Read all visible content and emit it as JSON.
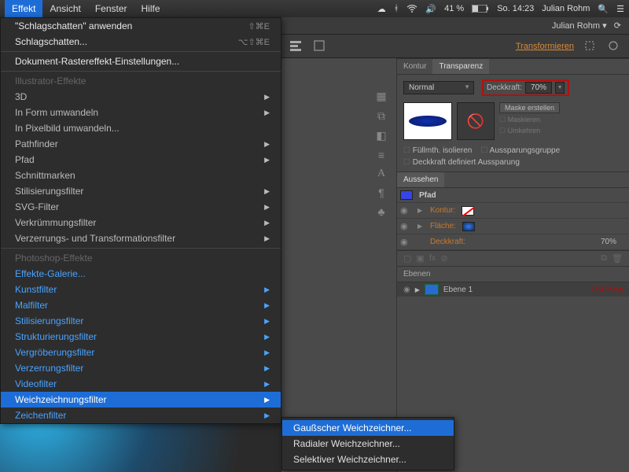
{
  "menubar": {
    "active": "Effekt",
    "items": [
      "Effekt",
      "Ansicht",
      "Fenster",
      "Hilfe"
    ],
    "battery": "41 %",
    "clock": "So. 14:23",
    "user": "Julian Rohm"
  },
  "dropdown": {
    "apply_last": "\"Schlagschatten\" anwenden",
    "apply_shortcut": "⇧⌘E",
    "last": "Schlagschatten...",
    "last_shortcut": "⌥⇧⌘E",
    "raster_settings": "Dokument-Rastereffekt-Einstellungen...",
    "section1": "Illustrator-Effekte",
    "ai_items": [
      "3D",
      "In Form umwandeln",
      "In Pixelbild umwandeln...",
      "Pathfinder",
      "Pfad",
      "Schnittmarken",
      "Stilisierungsfilter",
      "SVG-Filter",
      "Verkrümmungsfilter",
      "Verzerrungs- und Transformationsfilter"
    ],
    "section2": "Photoshop-Effekte",
    "ps_gallery": "Effekte-Galerie...",
    "ps_items": [
      "Kunstfilter",
      "Malfilter",
      "Stilisierungsfilter",
      "Strukturierungsfilter",
      "Vergröberungsfilter",
      "Verzerrungsfilter",
      "Videofilter",
      "Weichzeichnungsfilter",
      "Zeichenfilter"
    ]
  },
  "submenu": {
    "items": [
      "Gaußscher Weichzeichner...",
      "Radialer Weichzeichner...",
      "Selektiver Weichzeichner..."
    ]
  },
  "doc_user": "Julian Rohm",
  "toolbar": {
    "transform": "Transformieren"
  },
  "transparency": {
    "tab_stroke": "Kontur",
    "tab_transp": "Transparenz",
    "blend": "Normal",
    "opacity_label": "Deckkraft:",
    "opacity_value": "70%",
    "make_mask": "Maske erstellen",
    "clip": "Maskieren",
    "invert": "Umkehren",
    "isolate": "Füllmth. isolieren",
    "knockout": "Aussparungsgruppe",
    "define": "Deckkraft definiert Aussparung"
  },
  "appearance": {
    "title": "Aussehen",
    "object": "Pfad",
    "rows": [
      {
        "label": "Kontur:",
        "swatch": "none"
      },
      {
        "label": "Fläche:",
        "swatch": "blue"
      },
      {
        "label": "Deckkraft:",
        "value": "70%"
      }
    ]
  },
  "layers": {
    "title": "Ebenen",
    "name": "Ebene 1"
  }
}
